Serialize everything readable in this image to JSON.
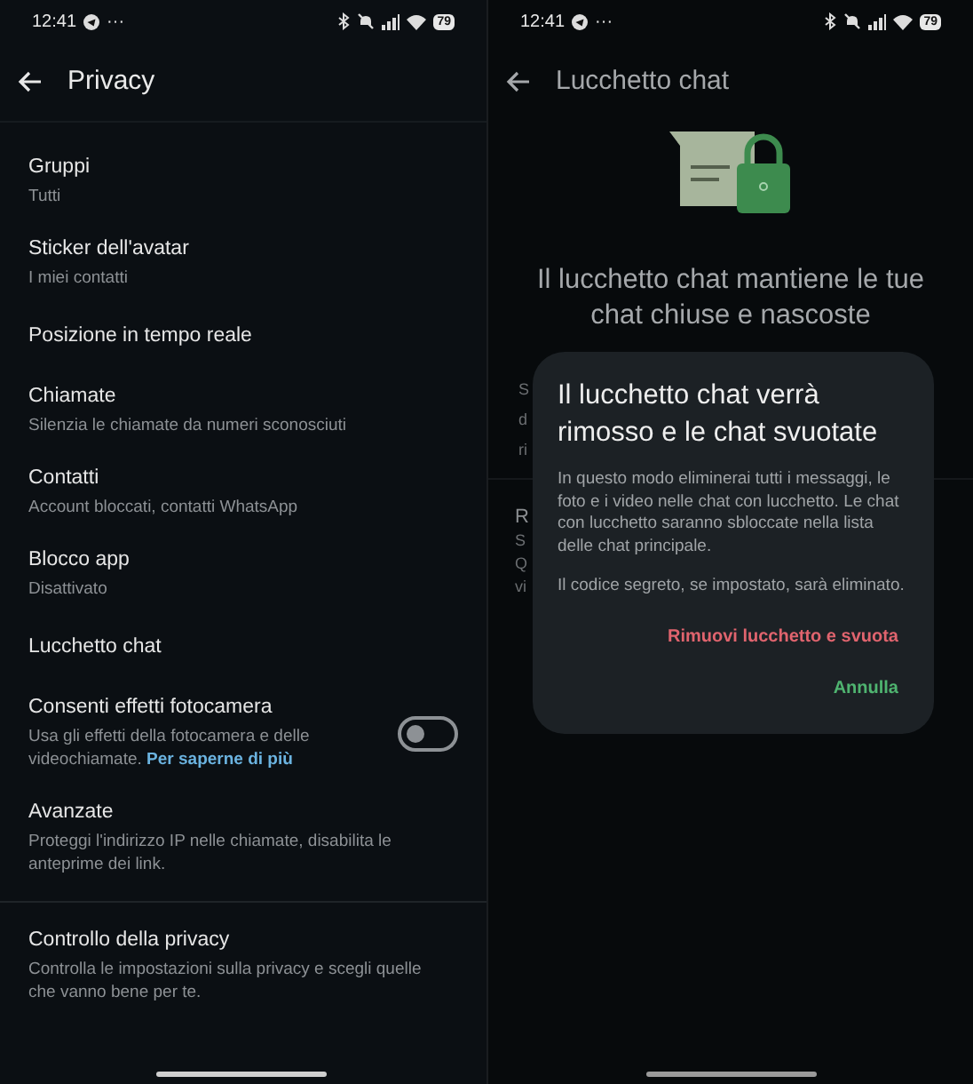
{
  "left": {
    "status": {
      "time": "12:41",
      "dots": "···",
      "battery": "79"
    },
    "title": "Privacy",
    "items": [
      {
        "kind": "plain",
        "title": "Gruppi",
        "subtitle": "Tutti"
      },
      {
        "kind": "plain",
        "title": "Sticker dell'avatar",
        "subtitle": "I miei contatti"
      },
      {
        "kind": "plain",
        "title": "Posizione in tempo reale"
      },
      {
        "kind": "plain",
        "title": "Chiamate",
        "subtitle": "Silenzia le chiamate da numeri sconosciuti"
      },
      {
        "kind": "plain",
        "title": "Contatti",
        "subtitle": "Account bloccati, contatti WhatsApp"
      },
      {
        "kind": "plain",
        "title": "Blocco app",
        "subtitle": "Disattivato"
      },
      {
        "kind": "plain",
        "title": "Lucchetto chat"
      },
      {
        "kind": "toggle",
        "title": "Consenti effetti fotocamera",
        "subtitle": "Usa gli effetti della fotocamera e delle videochiamate.",
        "link": "Per saperne di più",
        "on": false
      },
      {
        "kind": "plain",
        "title": "Avanzate",
        "subtitle": "Proteggi l'indirizzo IP nelle chiamate, disabilita le anteprime dei link.",
        "divider_after": true
      },
      {
        "kind": "plain",
        "title": "Controllo della privacy",
        "subtitle": "Controlla le impostazioni sulla privacy e scegli quelle che vanno bene per te."
      }
    ]
  },
  "right": {
    "status": {
      "time": "12:41",
      "dots": "···",
      "battery": "79"
    },
    "title": "Lucchetto chat",
    "heading": "Il lucchetto chat mantiene le tue chat chiuse e nascoste",
    "behind": [
      [
        "S",
        "d",
        "ri"
      ],
      [
        "R",
        "S",
        "Q",
        "vi"
      ]
    ],
    "dialog": {
      "title": "Il lucchetto chat verrà rimosso e le chat svuotate",
      "paragraphs": [
        "In questo modo eliminerai tutti i messaggi, le foto e i video nelle chat con lucchetto. Le chat con lucchetto saranno sbloccate nella lista delle chat principale.",
        "Il codice segreto, se impostato, sarà eliminato."
      ],
      "actions": [
        {
          "label": "Rimuovi lucchetto e svuota",
          "kind": "danger"
        },
        {
          "label": "Annulla",
          "kind": "confirm"
        }
      ]
    }
  }
}
